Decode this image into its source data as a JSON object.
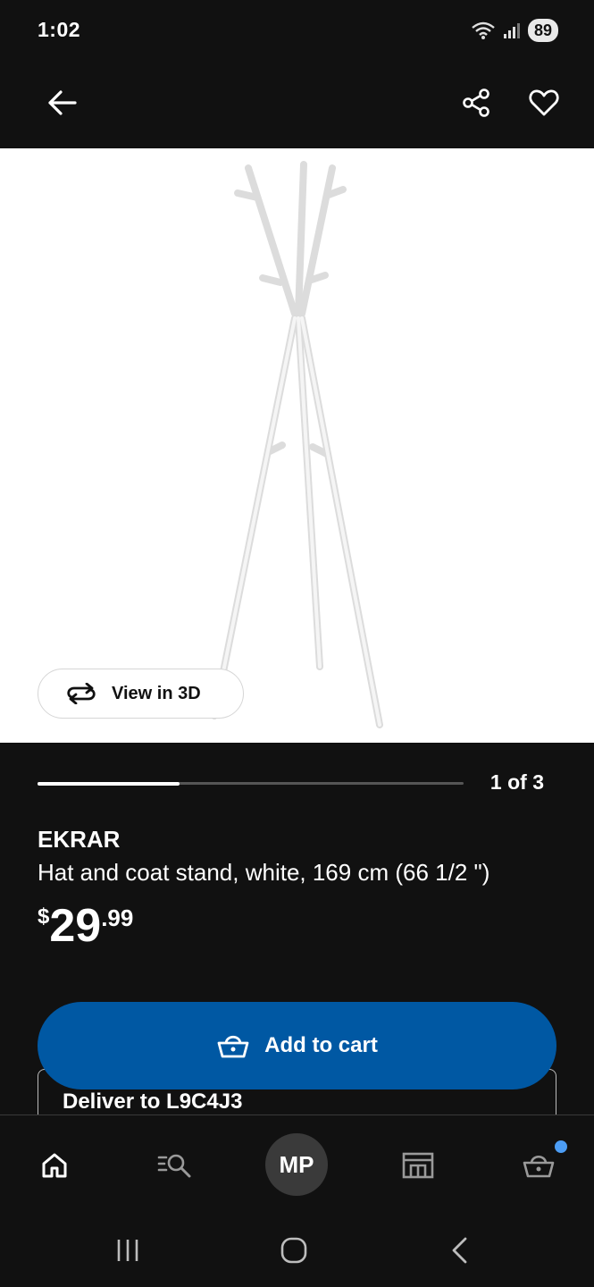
{
  "status_bar": {
    "time": "1:02",
    "battery": "89"
  },
  "app_bar": {
    "back_icon": "arrow-left-icon",
    "share_icon": "share-icon",
    "favorite_icon": "heart-icon"
  },
  "product": {
    "image_alt": "EKRAR hat and coat stand",
    "view_3d_label": "View in 3D",
    "gallery_position": "1 of 3",
    "gallery_progress_fraction": 0.333,
    "name": "EKRAR",
    "description": "Hat and coat stand, white, 169 cm (66 1/2 \")",
    "price": {
      "currency": "$",
      "whole": "29",
      "decimal": ".99"
    }
  },
  "delivery": {
    "label": "Deliver to L9C4J3"
  },
  "cart": {
    "add_label": "Add to cart"
  },
  "bottom_nav": {
    "profile_initials": "MP",
    "items": [
      "home-icon",
      "search-list-icon",
      "profile-avatar",
      "store-icon",
      "cart-icon"
    ],
    "cart_badge_color": "#4c9df5"
  },
  "colors": {
    "background": "#111111",
    "primary_button": "#0058a3"
  }
}
